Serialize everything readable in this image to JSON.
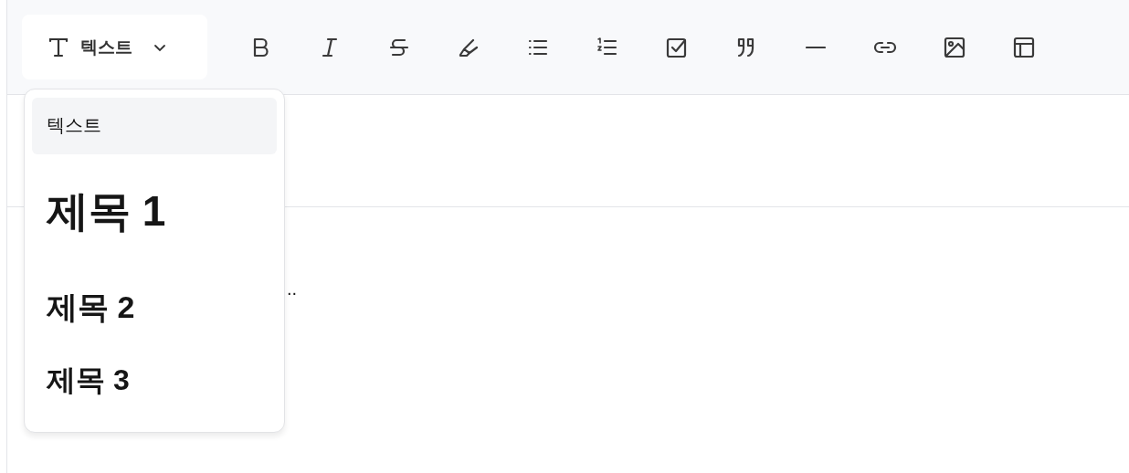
{
  "toolbar": {
    "block_type": {
      "label": "텍스트",
      "expanded": true
    }
  },
  "block_menu": [
    {
      "kind": "paragraph",
      "label": "텍스트",
      "selected": true
    },
    {
      "kind": "heading1",
      "label": "제목 1",
      "selected": false
    },
    {
      "kind": "heading2",
      "label": "제목 2",
      "selected": false
    },
    {
      "kind": "heading3",
      "label": "제목 3",
      "selected": false
    }
  ],
  "editor": {
    "partial_text": ".."
  }
}
